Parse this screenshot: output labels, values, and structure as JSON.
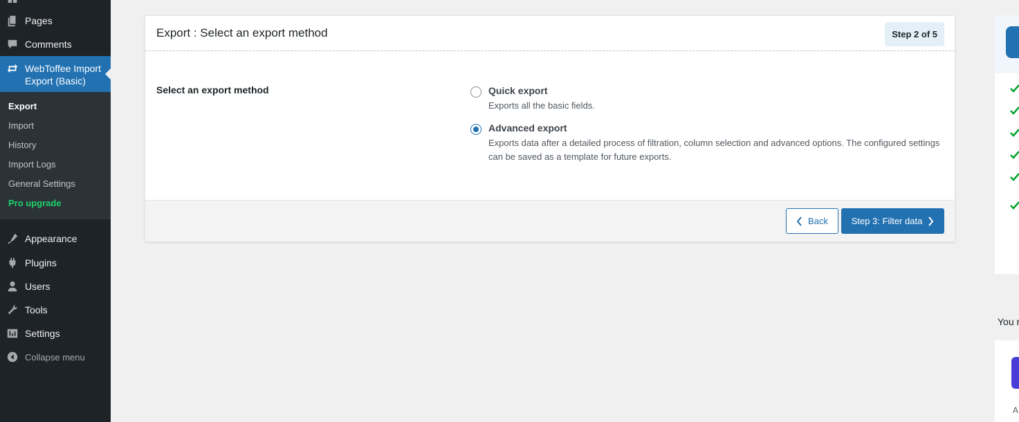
{
  "sidebar": {
    "items_top": [
      {
        "label": "Pages",
        "icon": "pages-icon"
      },
      {
        "label": "Comments",
        "icon": "comments-icon"
      }
    ],
    "current": {
      "label": "WebToffee Import Export (Basic)",
      "icon": "import-export-icon"
    },
    "submenu": [
      {
        "label": "Export"
      },
      {
        "label": "Import"
      },
      {
        "label": "History"
      },
      {
        "label": "Import Logs"
      },
      {
        "label": "General Settings"
      },
      {
        "label": "Pro upgrade"
      }
    ],
    "items_bottom": [
      {
        "label": "Appearance",
        "icon": "appearance-icon"
      },
      {
        "label": "Plugins",
        "icon": "plugins-icon"
      },
      {
        "label": "Users",
        "icon": "users-icon"
      },
      {
        "label": "Tools",
        "icon": "tools-icon"
      },
      {
        "label": "Settings",
        "icon": "settings-icon"
      }
    ],
    "collapse_label": "Collapse menu"
  },
  "panel": {
    "title": "Export : Select an export method",
    "step_badge": "Step 2 of 5",
    "section_label": "Select an export method",
    "options": [
      {
        "title": "Quick export",
        "description": "Exports all the basic fields.",
        "checked": false
      },
      {
        "title": "Advanced export",
        "description": "Exports data after a detailed process of filtration, column selection and advanced options. The configured settings can be saved as a template for future exports.",
        "checked": true
      }
    ],
    "back_label": "Back",
    "next_label": "Step 3: Filter data"
  },
  "right": {
    "text": "You r",
    "small_text": "A"
  },
  "colors": {
    "sidebar_bg": "#1d2327",
    "accent": "#2271b1",
    "pro_green": "#1ed06c",
    "check_green": "#00a32a"
  }
}
